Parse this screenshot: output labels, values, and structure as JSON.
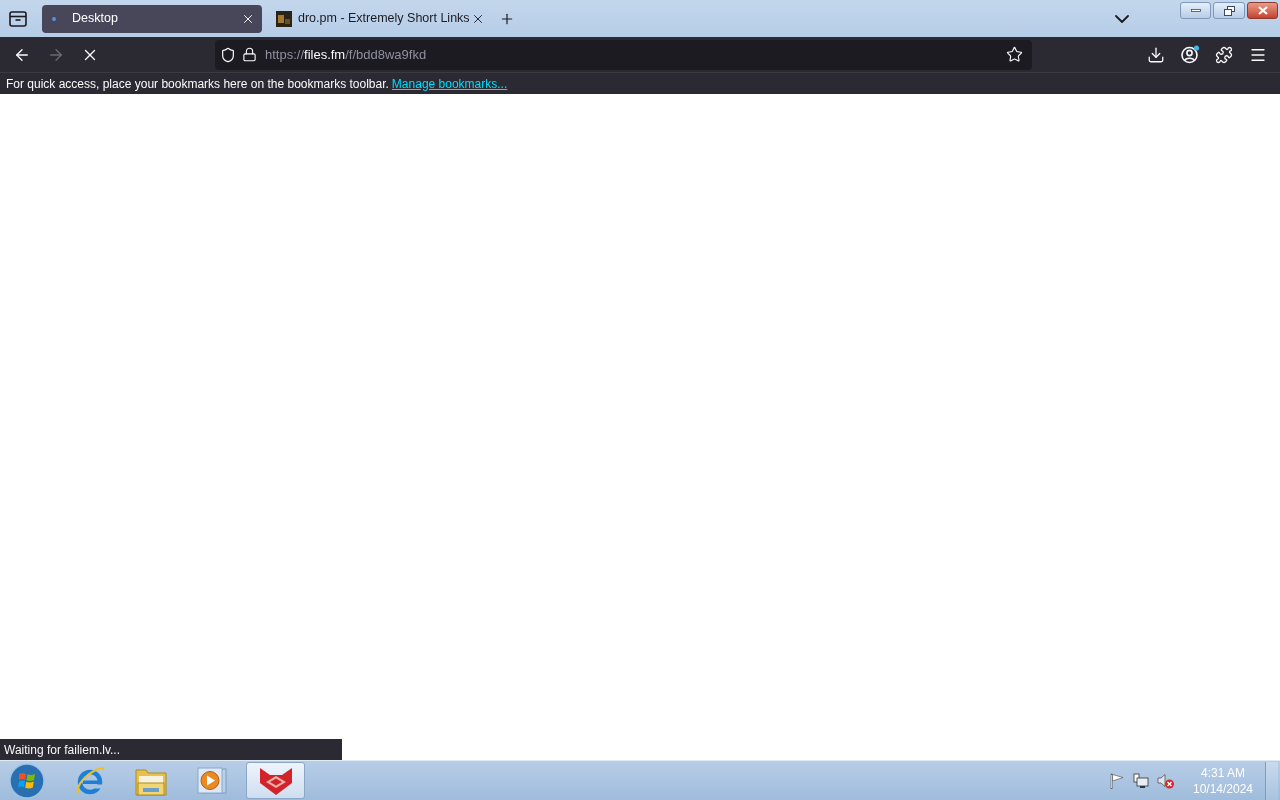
{
  "tabs": [
    {
      "title": "Desktop",
      "selected": true
    },
    {
      "title": "dro.pm - Extremely Short Links",
      "selected": false
    }
  ],
  "navigation": {
    "back_disabled": false,
    "forward_disabled": true,
    "loading": true
  },
  "address_bar": {
    "scheme": "https://",
    "host": "files.fm",
    "path": "/f/bdd8wa9fkd"
  },
  "bookmarks_toolbar": {
    "message": "For quick access, place your bookmarks here on the bookmarks toolbar.",
    "link": "Manage bookmarks..."
  },
  "status_text": "Waiting for failiem.lv...",
  "taskbar": {
    "apps": [
      {
        "kind": "browser",
        "active": false
      },
      {
        "kind": "folder",
        "active": false
      },
      {
        "kind": "media",
        "active": false
      },
      {
        "kind": "fox",
        "active": true
      }
    ],
    "tray": {
      "volume_muted": true,
      "time": "4:31 AM",
      "date": "10/14/2024"
    }
  }
}
